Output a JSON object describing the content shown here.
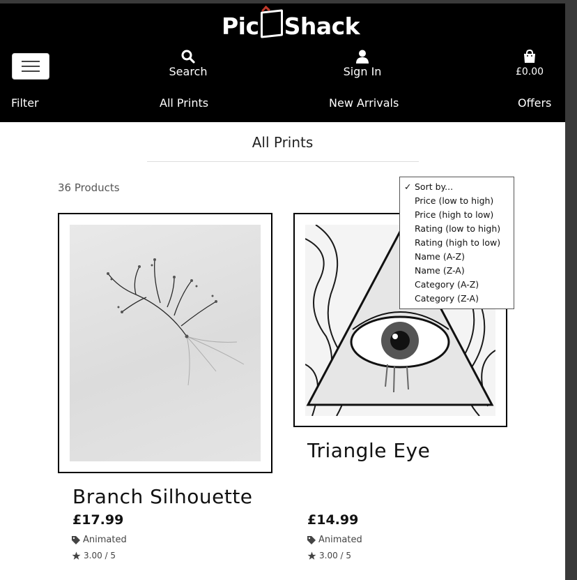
{
  "brand": {
    "logo_left": "Pic",
    "logo_right": "Shack"
  },
  "header": {
    "search_label": "Search",
    "signin_label": "Sign In",
    "cart_label": "£0.00"
  },
  "categories": [
    "Filter",
    "All Prints",
    "New Arrivals",
    "Offers"
  ],
  "page": {
    "title": "All Prints",
    "product_count": "36 Products"
  },
  "sort": {
    "options": [
      "Sort by...",
      "Price (low to high)",
      "Price (high to low)",
      "Rating (low to high)",
      "Rating (high to low)",
      "Name (A-Z)",
      "Name (Z-A)",
      "Category (A-Z)",
      "Category (Z-A)"
    ],
    "selected_index": 0,
    "check_mark": "✓"
  },
  "products": [
    {
      "name": "Branch Silhouette",
      "price": "£17.99",
      "category": "Animated",
      "rating": "3.00 / 5"
    },
    {
      "name": "Triangle Eye",
      "price": "£14.99",
      "category": "Animated",
      "rating": "3.00 / 5"
    }
  ],
  "icons": {
    "menu": "hamburger-icon",
    "search": "search-icon",
    "user": "user-icon",
    "cart": "shopping-bag-icon",
    "tag": "tag-icon",
    "star": "star-icon"
  },
  "colors": {
    "header_bg": "#000000",
    "accent_logo": "#c0392b"
  }
}
